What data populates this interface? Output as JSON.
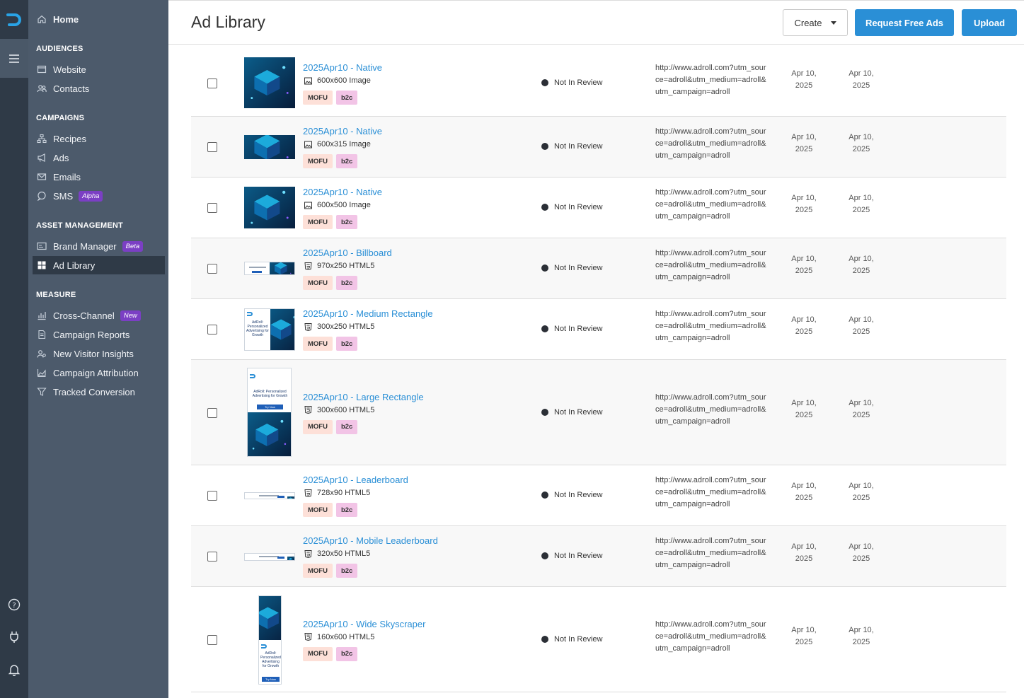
{
  "sidebar": {
    "home": "Home",
    "sections": [
      {
        "label": "AUDIENCES",
        "items": [
          {
            "label": "Website",
            "icon": "browser-icon"
          },
          {
            "label": "Contacts",
            "icon": "users-icon"
          }
        ]
      },
      {
        "label": "CAMPAIGNS",
        "items": [
          {
            "label": "Recipes",
            "icon": "hierarchy-icon"
          },
          {
            "label": "Ads",
            "icon": "megaphone-icon"
          },
          {
            "label": "Emails",
            "icon": "envelope-icon"
          },
          {
            "label": "SMS",
            "icon": "chat-icon",
            "badge": "Alpha"
          }
        ]
      },
      {
        "label": "ASSET MANAGEMENT",
        "items": [
          {
            "label": "Brand Manager",
            "icon": "card-icon",
            "badge": "Beta"
          },
          {
            "label": "Ad Library",
            "icon": "grid-icon",
            "active": true
          }
        ]
      },
      {
        "label": "MEASURE",
        "items": [
          {
            "label": "Cross-Channel",
            "icon": "bar-chart-icon",
            "badge": "New"
          },
          {
            "label": "Campaign Reports",
            "icon": "document-icon"
          },
          {
            "label": "New Visitor Insights",
            "icon": "visitor-icon"
          },
          {
            "label": "Campaign Attribution",
            "icon": "area-chart-icon"
          },
          {
            "label": "Tracked Conversion",
            "icon": "funnel-icon"
          }
        ]
      }
    ]
  },
  "header": {
    "title": "Ad Library",
    "create_label": "Create",
    "request_label": "Request Free Ads",
    "upload_label": "Upload"
  },
  "rows": [
    {
      "title": "2025Apr10 - Native",
      "meta": "600x600 Image",
      "kind": "image",
      "tags": [
        "MOFU",
        "b2c"
      ],
      "status": "Not In Review",
      "url": "http://www.adroll.com?utm_source=adroll&utm_medium=adroll&utm_campaign=adroll",
      "created": "Apr 10, 2025",
      "updated": "Apr 10, 2025"
    },
    {
      "title": "2025Apr10 - Native",
      "meta": "600x315 Image",
      "kind": "image",
      "tags": [
        "MOFU",
        "b2c"
      ],
      "status": "Not In Review",
      "url": "http://www.adroll.com?utm_source=adroll&utm_medium=adroll&utm_campaign=adroll",
      "created": "Apr 10, 2025",
      "updated": "Apr 10, 2025"
    },
    {
      "title": "2025Apr10 - Native",
      "meta": "600x500 Image",
      "kind": "image",
      "tags": [
        "MOFU",
        "b2c"
      ],
      "status": "Not In Review",
      "url": "http://www.adroll.com?utm_source=adroll&utm_medium=adroll&utm_campaign=adroll",
      "created": "Apr 10, 2025",
      "updated": "Apr 10, 2025"
    },
    {
      "title": "2025Apr10 - Billboard",
      "meta": "970x250 HTML5",
      "kind": "html5",
      "tags": [
        "MOFU",
        "b2c"
      ],
      "status": "Not In Review",
      "url": "http://www.adroll.com?utm_source=adroll&utm_medium=adroll&utm_campaign=adroll",
      "created": "Apr 10, 2025",
      "updated": "Apr 10, 2025"
    },
    {
      "title": "2025Apr10 - Medium Rectangle",
      "meta": "300x250 HTML5",
      "kind": "html5",
      "tags": [
        "MOFU",
        "b2c"
      ],
      "status": "Not In Review",
      "url": "http://www.adroll.com?utm_source=adroll&utm_medium=adroll&utm_campaign=adroll",
      "created": "Apr 10, 2025",
      "updated": "Apr 10, 2025",
      "thumb_text": "AdRoll: Personalized Advertising for Growth"
    },
    {
      "title": "2025Apr10 - Large Rectangle",
      "meta": "300x600 HTML5",
      "kind": "html5",
      "tags": [
        "MOFU",
        "b2c"
      ],
      "status": "Not In Review",
      "url": "http://www.adroll.com?utm_source=adroll&utm_medium=adroll&utm_campaign=adroll",
      "created": "Apr 10, 2025",
      "updated": "Apr 10, 2025",
      "thumb_text": "AdRoll: Personalized Advertising for Growth",
      "thumb_cta": "Try Now"
    },
    {
      "title": "2025Apr10 - Leaderboard",
      "meta": "728x90 HTML5",
      "kind": "html5",
      "tags": [
        "MOFU",
        "b2c"
      ],
      "status": "Not In Review",
      "url": "http://www.adroll.com?utm_source=adroll&utm_medium=adroll&utm_campaign=adroll",
      "created": "Apr 10, 2025",
      "updated": "Apr 10, 2025"
    },
    {
      "title": "2025Apr10 - Mobile Leaderboard",
      "meta": "320x50 HTML5",
      "kind": "html5",
      "tags": [
        "MOFU",
        "b2c"
      ],
      "status": "Not In Review",
      "url": "http://www.adroll.com?utm_source=adroll&utm_medium=adroll&utm_campaign=adroll",
      "created": "Apr 10, 2025",
      "updated": "Apr 10, 2025"
    },
    {
      "title": "2025Apr10 - Wide Skyscraper",
      "meta": "160x600 HTML5",
      "kind": "html5",
      "tags": [
        "MOFU",
        "b2c"
      ],
      "status": "Not In Review",
      "url": "http://www.adroll.com?utm_source=adroll&utm_medium=adroll&utm_campaign=adroll",
      "created": "Apr 10, 2025",
      "updated": "Apr 10, 2025",
      "thumb_text": "AdRoll: Personalized Advertising for Growth",
      "thumb_cta": "Try Now"
    }
  ],
  "colors": {
    "accent": "#2a8fd6",
    "sidebar": "#4c5a6b",
    "rail": "#2f3a47",
    "mofu": "#fde0d8",
    "b2c": "#f2c4e6",
    "badge": "#7b3fc4"
  }
}
